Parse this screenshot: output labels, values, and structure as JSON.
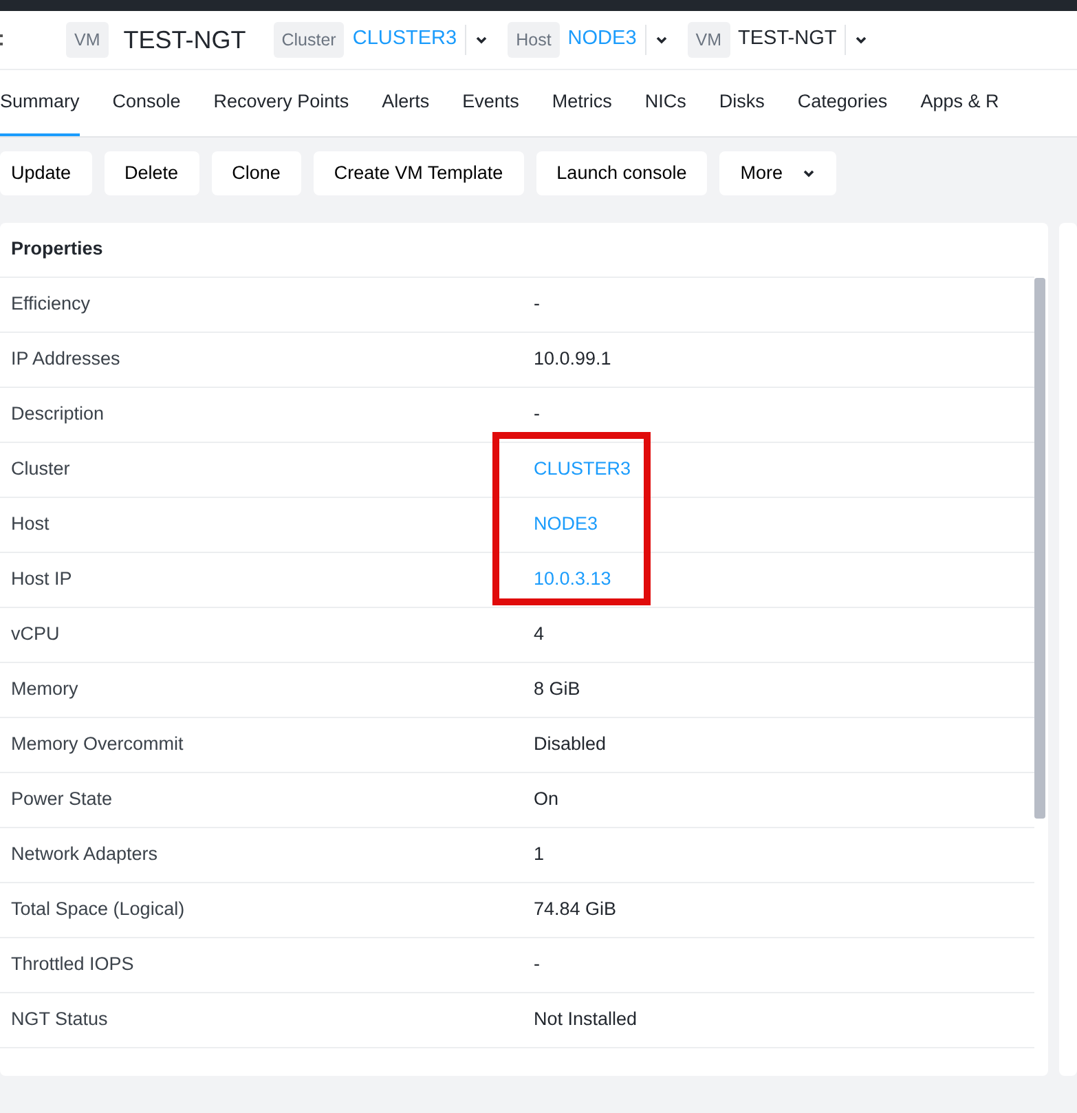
{
  "header": {
    "type_tag": "VM",
    "title": "TEST-NGT",
    "crumbs": [
      {
        "tag": "Cluster",
        "value": "CLUSTER3",
        "kind": "link"
      },
      {
        "tag": "Host",
        "value": "NODE3",
        "kind": "link"
      },
      {
        "tag": "VM",
        "value": "TEST-NGT",
        "kind": "text"
      }
    ]
  },
  "tabs": [
    {
      "label": "Summary",
      "selected": true
    },
    {
      "label": "Console",
      "selected": false
    },
    {
      "label": "Recovery Points",
      "selected": false
    },
    {
      "label": "Alerts",
      "selected": false
    },
    {
      "label": "Events",
      "selected": false
    },
    {
      "label": "Metrics",
      "selected": false
    },
    {
      "label": "NICs",
      "selected": false
    },
    {
      "label": "Disks",
      "selected": false
    },
    {
      "label": "Categories",
      "selected": false
    },
    {
      "label": "Apps & R",
      "selected": false
    }
  ],
  "actions": [
    {
      "label": "Update",
      "kind": "plain"
    },
    {
      "label": "Delete",
      "kind": "plain"
    },
    {
      "label": "Clone",
      "kind": "plain"
    },
    {
      "label": "Create VM Template",
      "kind": "plain"
    },
    {
      "label": "Launch console",
      "kind": "plain"
    },
    {
      "label": "More",
      "kind": "dropdown"
    }
  ],
  "properties": {
    "title": "Properties",
    "rows": [
      {
        "label": "Efficiency",
        "value": "-",
        "kind": "text",
        "highlighted": false
      },
      {
        "label": "IP Addresses",
        "value": "10.0.99.1",
        "kind": "text",
        "highlighted": false
      },
      {
        "label": "Description",
        "value": "-",
        "kind": "text",
        "highlighted": false
      },
      {
        "label": "Cluster",
        "value": "CLUSTER3",
        "kind": "link",
        "highlighted": true
      },
      {
        "label": "Host",
        "value": "NODE3",
        "kind": "link",
        "highlighted": true
      },
      {
        "label": "Host IP",
        "value": "10.0.3.13",
        "kind": "link",
        "highlighted": true
      },
      {
        "label": "vCPU",
        "value": "4",
        "kind": "text",
        "highlighted": false
      },
      {
        "label": "Memory",
        "value": "8 GiB",
        "kind": "text",
        "highlighted": false
      },
      {
        "label": "Memory Overcommit",
        "value": "Disabled",
        "kind": "text",
        "highlighted": false
      },
      {
        "label": "Power State",
        "value": "On",
        "kind": "text",
        "highlighted": false
      },
      {
        "label": "Network Adapters",
        "value": "1",
        "kind": "text",
        "highlighted": false
      },
      {
        "label": "Total Space (Logical)",
        "value": "74.84 GiB",
        "kind": "text",
        "highlighted": false
      },
      {
        "label": "Throttled IOPS",
        "value": "-",
        "kind": "text",
        "highlighted": false
      },
      {
        "label": "NGT Status",
        "value": "Not Installed",
        "kind": "text",
        "highlighted": false
      }
    ]
  }
}
